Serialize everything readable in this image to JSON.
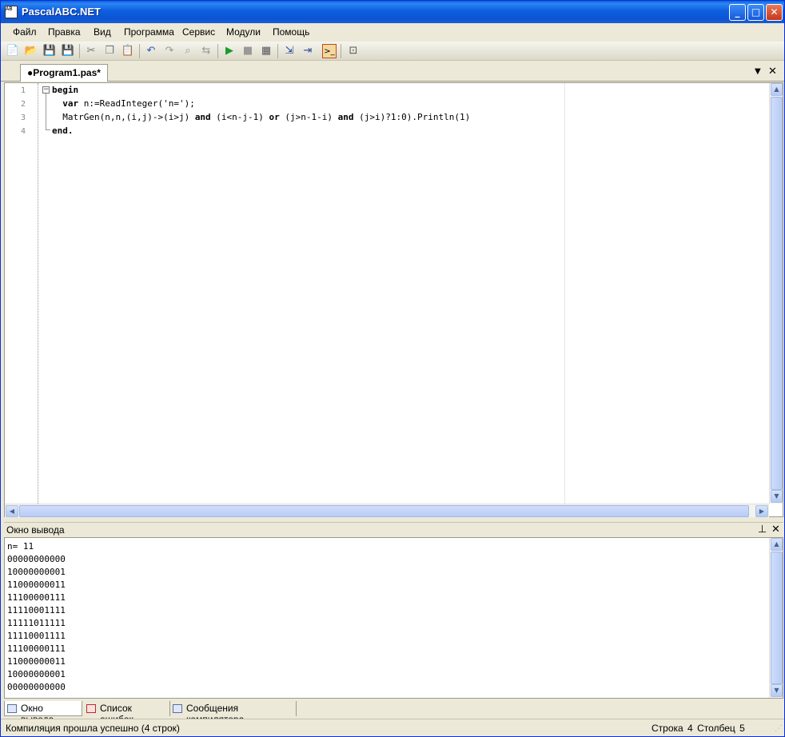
{
  "window": {
    "title": "PascalABC.NET",
    "icon_text": "AB"
  },
  "menu": [
    "Файл",
    "Правка",
    "Вид",
    "Программа",
    "Сервис",
    "Модули",
    "Помощь"
  ],
  "toolbar_icons": [
    "new-file-icon",
    "open-file-icon",
    "save-icon",
    "save-all-icon",
    "cut-icon",
    "copy-icon",
    "paste-icon",
    "undo-icon",
    "redo-icon",
    "find-icon",
    "replace-icon",
    "run-icon",
    "stop-icon",
    "compile-icon",
    "step-into-icon",
    "step-over-icon",
    "output-window-icon",
    "breakpoint-icon"
  ],
  "tab": {
    "label": "●Program1.pas*"
  },
  "editor": {
    "line_numbers": [
      "1",
      "2",
      "3",
      "4"
    ],
    "lines": [
      {
        "kw": "begin",
        "text": ""
      },
      {
        "kw": "  var",
        "text": " n:=ReadInteger('n=');"
      },
      {
        "kw": "",
        "text": "  MatrGen(n,n,(i,j)->(i>j) ",
        "kw2": "and",
        "text2": " (i<n-j-1) ",
        "kw3": "or",
        "text3": " (j>n-1-i) ",
        "kw4": "and",
        "text4": " (j>i)?1:0).Println(1)"
      },
      {
        "kw": "end.",
        "text": ""
      }
    ]
  },
  "output_panel": {
    "title": "Окно вывода",
    "text": "n= 11\n00000000000\n10000000001\n11000000011\n11100000111\n11110001111\n11111011111\n11110001111\n11100000111\n11000000011\n10000000001\n00000000000"
  },
  "bottom_tabs": [
    "Окно вывода",
    "Список ошибок",
    "Сообщения компилятора"
  ],
  "status": {
    "message": "Компиляция прошла успешно (4 строк)",
    "line_label": "Строка",
    "line_value": "4",
    "col_label": "Столбец",
    "col_value": "5"
  }
}
